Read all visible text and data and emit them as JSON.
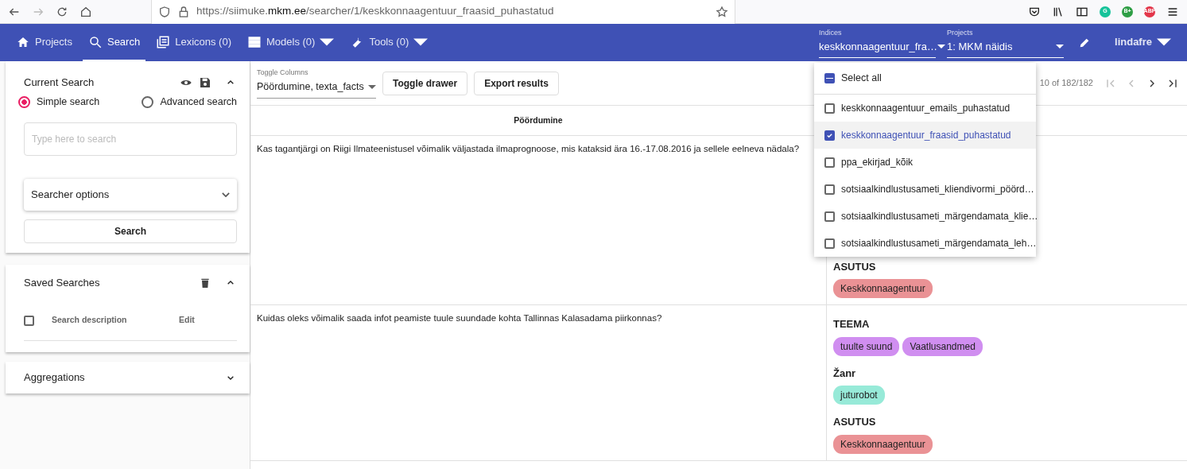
{
  "browser": {
    "url": "https://siimuke.**mkm.ee**/searcher/1/keskkonnaagentuur_fraasid_puhastatud",
    "extensions": [
      {
        "label": "G",
        "color": "#15c39a"
      },
      {
        "label": "B+",
        "color": "#2e9e45"
      },
      {
        "label": "ABP",
        "color": "#e3364a"
      }
    ]
  },
  "navbar": {
    "items": [
      {
        "label": "Projects",
        "selected": false,
        "dropdown": false
      },
      {
        "label": "Search",
        "selected": true,
        "dropdown": false
      },
      {
        "label": "Lexicons (0)",
        "selected": false,
        "dropdown": false
      },
      {
        "label": "Models (0)",
        "selected": false,
        "dropdown": true
      },
      {
        "label": "Tools (0)",
        "selected": false,
        "dropdown": true
      }
    ],
    "indices": {
      "label": "Indices",
      "value": "keskkonnaagentuur_fra…"
    },
    "projects": {
      "label": "Projects",
      "value": "1: MKM näidis"
    },
    "user": "lindafre"
  },
  "sidebar": {
    "current_search": {
      "title": "Current Search",
      "expanded": true,
      "modes": [
        {
          "label": "Simple search",
          "selected": true
        },
        {
          "label": "Advanced search",
          "selected": false
        }
      ],
      "placeholder": "Type here to search",
      "options_label": "Searcher options",
      "search_button": "Search"
    },
    "saved_searches": {
      "title": "Saved Searches",
      "expanded": true,
      "checked": false,
      "description": "Search description",
      "edit": "Edit"
    },
    "aggregations": {
      "title": "Aggregations",
      "expanded": false
    }
  },
  "toolbar": {
    "toggle_columns": {
      "label": "Toggle Columns",
      "value": "Pöördumine, texta_facts"
    },
    "buttons": [
      "Toggle drawer",
      "Export results"
    ],
    "pager": "10 of 182/182"
  },
  "table": {
    "columns": [
      "Pöördumine"
    ],
    "rows": [
      {
        "text": "Kas tagantjärgi on Riigi Ilmateenistusel võimalik väljastada ilmaprognoose, mis kataksid ära 16.-17.08.2016 ja sellele eelneva nädala?",
        "facts": [
          {
            "name": "ASUTUS",
            "tags": [
              {
                "label": "Keskkonnaagentuur",
                "color": "#ea9295"
              }
            ]
          }
        ]
      },
      {
        "text": "Kuidas oleks võimalik saada infot peamiste tuule suundade kohta Tallinnas Kalasadama piirkonnas?",
        "facts": [
          {
            "name": "TEEMA",
            "tags": [
              {
                "label": "tuulte suund",
                "color": "#d08ef0"
              },
              {
                "label": "Vaatlusandmed",
                "color": "#d08ef0"
              }
            ]
          },
          {
            "name": "Žanr",
            "tags": [
              {
                "label": "juturobot",
                "color": "#97ead8"
              }
            ]
          },
          {
            "name": "ASUTUS",
            "tags": [
              {
                "label": "Keskkonnaagentuur",
                "color": "#ea9295"
              }
            ]
          }
        ]
      }
    ]
  },
  "indices_dropdown": {
    "select_all": {
      "label": "Select all",
      "indeterminate": true
    },
    "items": [
      {
        "label": "keskkonnaagentuur_emails_puhastatud",
        "checked": false
      },
      {
        "label": "keskkonnaagentuur_fraasid_puhastatud",
        "checked": true
      },
      {
        "label": "ppa_ekirjad_kõik",
        "checked": false
      },
      {
        "label": "sotsiaalkindlustusameti_kliendivormi_pöörd…",
        "checked": false
      },
      {
        "label": "sotsiaalkindlustusameti_märgendamata_klie…",
        "checked": false
      },
      {
        "label": "sotsiaalkindlustusameti_märgendamata_leh…",
        "checked": false
      }
    ]
  }
}
